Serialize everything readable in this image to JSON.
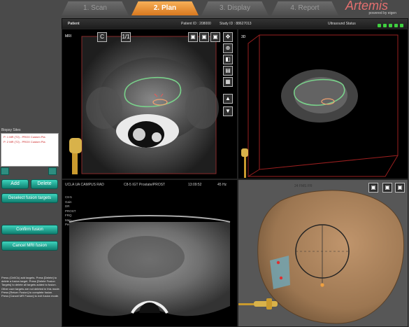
{
  "tabs": [
    {
      "label": "1. Scan",
      "active": false
    },
    {
      "label": "2. Plan",
      "active": true
    },
    {
      "label": "3. Display",
      "active": false
    },
    {
      "label": "4. Report",
      "active": false
    }
  ],
  "brand": {
    "name": "Artemis",
    "sub": "powered by eigen"
  },
  "status_bar": {
    "patient_label": "Patient",
    "patient_id": "Patient ID : 208000",
    "study_id": "Study ID : 88627013",
    "indicator": "Ultrasound Status"
  },
  "mri_view": {
    "label": "MRI",
    "mode_button": "C",
    "scale_button": "1/1"
  },
  "volume_view": {
    "label": "3D"
  },
  "biopsy": {
    "label": "Biopsy Sites",
    "sites": [
      "P: 1  MR (T2) - PROX Custom Pla",
      "P: 2  MR (T2) - PROX Custom Pla"
    ]
  },
  "buttons": {
    "add": "Add",
    "delete": "Delete",
    "deselect": "Deselect fusion targets",
    "confirm": "Confirm fusion",
    "cancel": "Cancel MRI fusion"
  },
  "help_text": "Press (Ctrl/Ck) add targets. Press [Delete] to delete a fusion target. Press [Delete Fusion Targets] to delete all targets added to fusion. Other user targets are not deleted in this mode. Press [Return Fusion] to complete fusion. Press [Cancel MR Fusion] to exit fusion mode.",
  "us_view": {
    "hospital": "UCLA UA CAMPUS RAD",
    "probe": "C8-5 IGT Prostate/PROST",
    "clock": "13:09:52",
    "fps": "45 Hz",
    "params": [
      "C8-5",
      "Gain",
      "DR",
      "PROST",
      "FRQ",
      "Map",
      "Pers"
    ]
  },
  "model_view": {
    "gauge_top": "24 FMS FR"
  }
}
